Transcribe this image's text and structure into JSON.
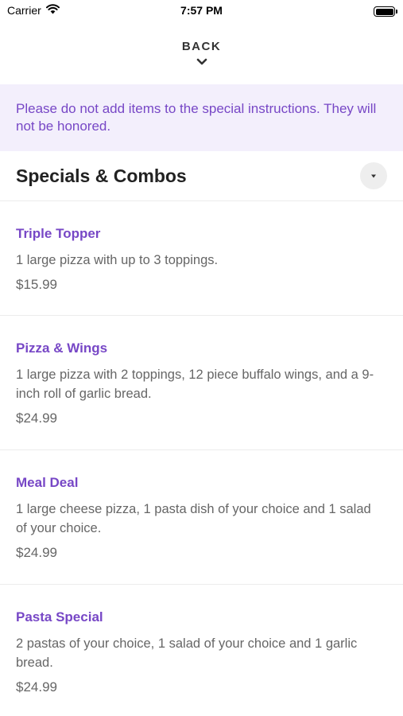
{
  "status_bar": {
    "carrier": "Carrier",
    "time": "7:57 PM",
    "wifi_icon": "wifi-icon",
    "battery_icon": "battery-icon"
  },
  "nav": {
    "back_label": "BACK",
    "chevron_icon": "chevron-down-icon"
  },
  "notice": {
    "text": "Please do not add items to the special instructions. They will not be honored."
  },
  "section": {
    "title": "Specials & Combos",
    "toggle_icon": "caret-down-icon"
  },
  "items": [
    {
      "name": "Triple Topper",
      "description": "1 large pizza with up to 3 toppings.",
      "price": "$15.99"
    },
    {
      "name": "Pizza & Wings",
      "description": "1 large pizza with 2 toppings, 12 piece buffalo wings, and a 9-inch roll of garlic bread.",
      "price": "$24.99"
    },
    {
      "name": "Meal Deal",
      "description": "1 large cheese pizza, 1 pasta dish of your choice and 1 salad of your choice.",
      "price": "$24.99"
    },
    {
      "name": "Pasta Special",
      "description": "2 pastas of your choice, 1 salad of your choice and 1 garlic bread.",
      "price": "$24.99"
    }
  ],
  "colors": {
    "accent": "#7747c6",
    "notice_bg": "#f3effc",
    "divider": "#ececec"
  }
}
